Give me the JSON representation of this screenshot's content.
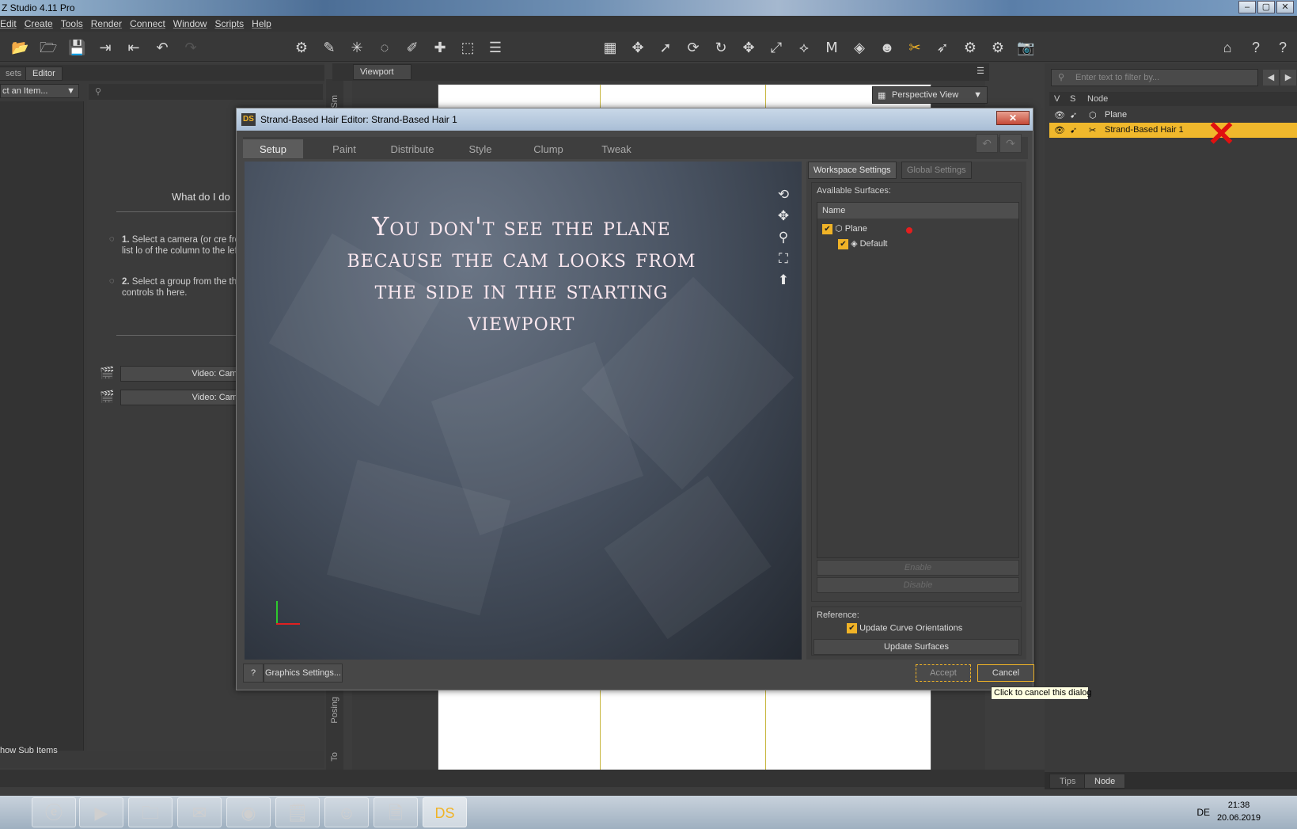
{
  "app": {
    "title": "Z Studio 4.11 Pro",
    "win_min": "–",
    "win_max": "▢",
    "win_close": "✕"
  },
  "menu": [
    "Edit",
    "Create",
    "Tools",
    "Render",
    "Connect",
    "Window",
    "Scripts",
    "Help"
  ],
  "left_panel": {
    "tab_inactive": "sets",
    "tab_active": "Editor",
    "selector": "ct an Item...",
    "heading": "What do I do",
    "step1_num": "1.",
    "step1": "Select a camera (or cre from the drop-down list lo of the column to the left.",
    "step2_num": "2.",
    "step2": "Select a group from the then adjust the controls th here.",
    "video1": "Video: Camera I",
    "video2": "Video: Cameras",
    "show_sub": "how Sub Items"
  },
  "viewport": {
    "tab": "Viewport",
    "view_select": "Perspective View",
    "side_label_top": "Sm",
    "side_label_posing": "Posing",
    "side_label_tools": "To"
  },
  "scene": {
    "filter_placeholder": "Enter text to filter by...",
    "col_v": "V",
    "col_s": "S",
    "col_node": "Node",
    "nodes": [
      {
        "name": "Plane",
        "selected": false
      },
      {
        "name": "Strand-Based Hair 1",
        "selected": true
      }
    ],
    "bottom_tabs": [
      "Tips",
      "Node"
    ]
  },
  "dialog": {
    "badge": "DS",
    "title": "Strand-Based Hair Editor: Strand-Based Hair 1",
    "close": "✕",
    "tabs": [
      "Setup",
      "Paint",
      "Distribute",
      "Style",
      "Clump",
      "Tweak"
    ],
    "active_tab": "Setup",
    "overlay_text": "You don't see the plane because the cam looks from the side in the starting viewport",
    "workspace_tab": "Workspace Settings",
    "global_tab": "Global Settings",
    "available_surfaces": "Available Surfaces:",
    "col_name": "Name",
    "surfaces": [
      {
        "name": "Plane",
        "checked": true
      },
      {
        "name": "Default",
        "checked": true
      }
    ],
    "enable_btn": "Enable",
    "disable_btn": "Disable",
    "reference_label": "Reference:",
    "update_orient": "Update Curve Orientations",
    "update_surfaces": "Update Surfaces",
    "help": "?",
    "graphics_settings": "Graphics Settings...",
    "accept": "Accept",
    "cancel": "Cancel",
    "tooltip": "Click to cancel this dialog"
  },
  "taskbar": {
    "lang": "DE",
    "time": "21:38",
    "date": "20.06.2019"
  },
  "colors": {
    "accent": "#f0b327",
    "selection": "#f0b82c",
    "marker": "#e01010"
  }
}
